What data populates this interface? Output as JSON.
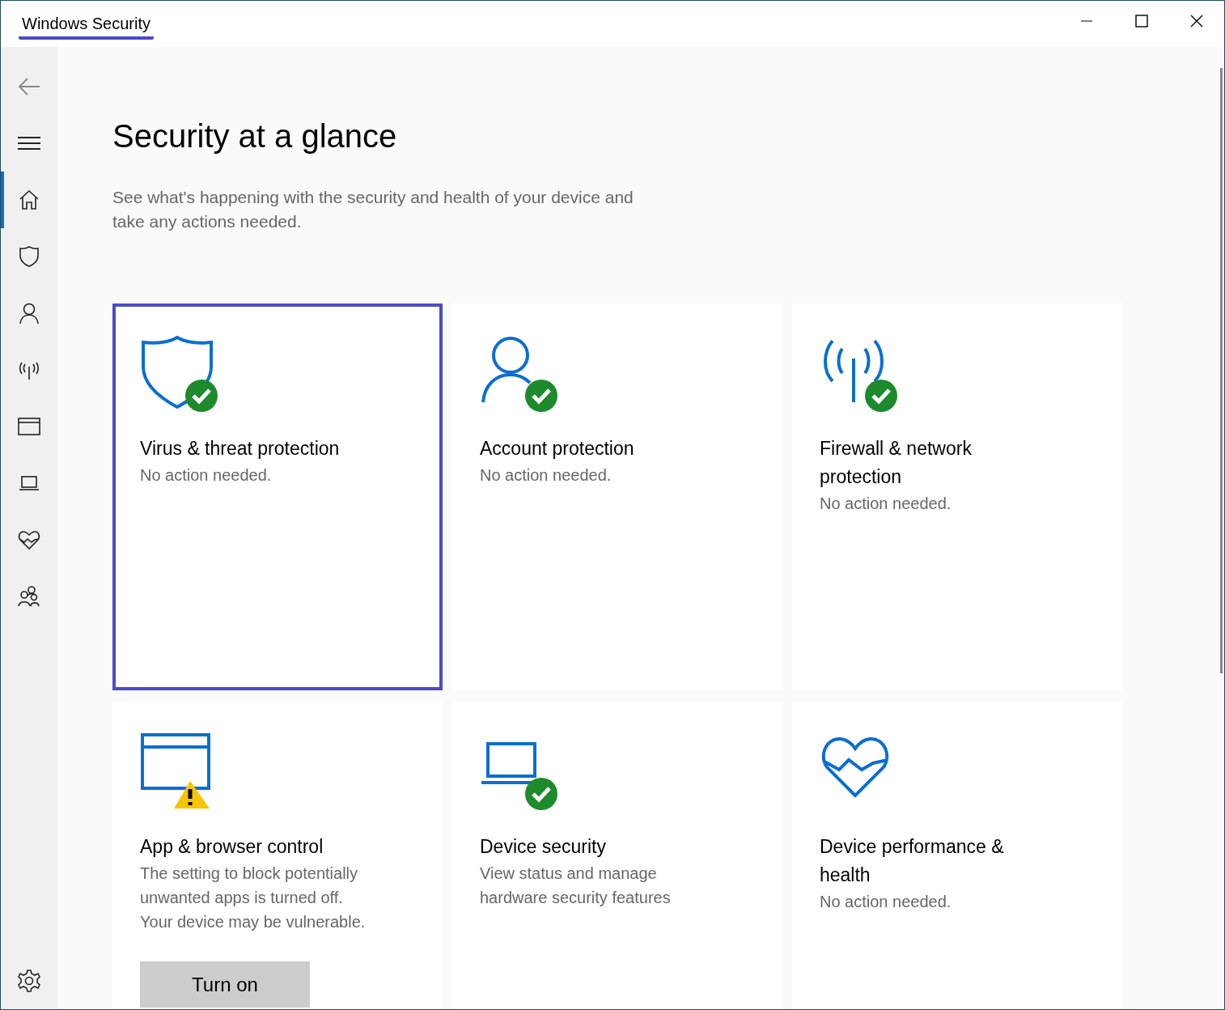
{
  "window": {
    "title": "Windows Security",
    "title_highlighted": true
  },
  "sidebar": {
    "items": [
      {
        "kind": "home",
        "selected": true
      },
      {
        "kind": "shield",
        "selected": false
      },
      {
        "kind": "person",
        "selected": false
      },
      {
        "kind": "antenna",
        "selected": false
      },
      {
        "kind": "browser",
        "selected": false
      },
      {
        "kind": "laptop",
        "selected": false
      },
      {
        "kind": "heart",
        "selected": false
      },
      {
        "kind": "family",
        "selected": false
      }
    ]
  },
  "page": {
    "heading": "Security at a glance",
    "description": "See what's happening with the security and health of your device and take any actions needed."
  },
  "cards": [
    {
      "kind": "shield",
      "healthy": true,
      "warning": false,
      "selected": true,
      "title": "Virus & threat protection",
      "description": "No action needed."
    },
    {
      "kind": "person",
      "healthy": true,
      "warning": false,
      "selected": false,
      "title": "Account protection",
      "description": "No action needed."
    },
    {
      "kind": "antenna",
      "healthy": true,
      "warning": false,
      "selected": false,
      "title": "Firewall & network protection",
      "description": "No action needed."
    },
    {
      "kind": "browser",
      "healthy": false,
      "warning": true,
      "selected": false,
      "title": "App & browser control",
      "description": "The setting to block potentially unwanted apps is turned off. Your device may be vulnerable.",
      "button": "Turn on"
    },
    {
      "kind": "laptop",
      "healthy": true,
      "warning": false,
      "selected": false,
      "title": "Device security",
      "description": "View status and manage hardware security features"
    },
    {
      "kind": "heart",
      "healthy": false,
      "warning": false,
      "selected": false,
      "title": "Device performance & health",
      "description": "No action needed."
    }
  ]
}
